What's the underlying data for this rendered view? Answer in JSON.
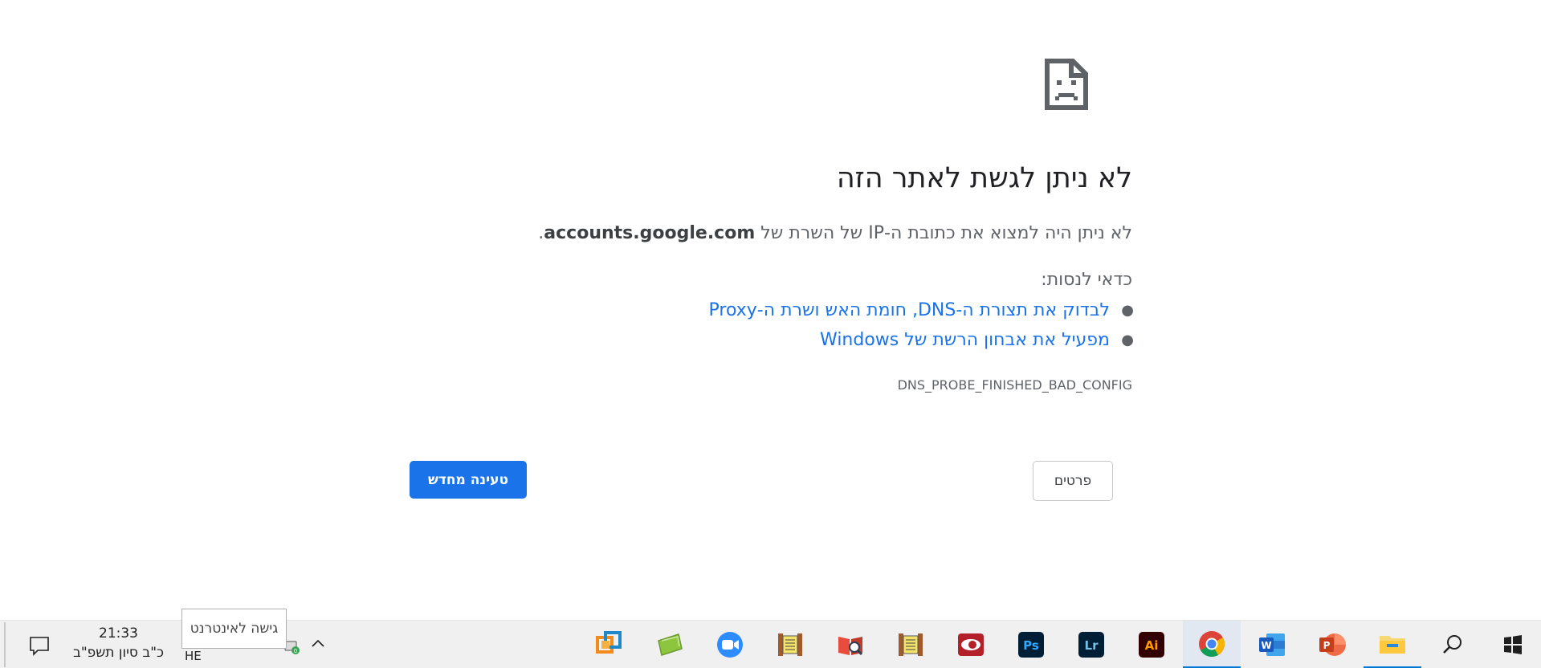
{
  "error": {
    "icon": "sad-document-icon",
    "title": "לא ניתן לגשת לאתר הזה",
    "desc_prefix": "לא ניתן היה למצוא את כתובת ה-IP של השרת של",
    "host": "accounts.google.com",
    "desc_suffix": ".",
    "try_label": "כדאי לנסות:",
    "suggestions": [
      "לבדוק את תצורת ה-DNS, חומת האש ושרת ה-Proxy",
      "מפעיל את אבחון הרשת של Windows"
    ],
    "code": "DNS_PROBE_FINISHED_BAD_CONFIG"
  },
  "buttons": {
    "details": "פרטים",
    "reload": "טעינה מחדש"
  },
  "taskbar": {
    "time": "21:33",
    "date": "כ\"ב סיון תשפ\"ב",
    "language": "HE",
    "tooltip": "גישה לאינטרנט",
    "apps": [
      "virtualbox-icon",
      "green-app-icon",
      "zoom-icon",
      "torah-scroll-icon",
      "book-search-icon",
      "torah-scroll-icon",
      "red-eye-app-icon",
      "photoshop-icon",
      "lightroom-icon",
      "illustrator-icon",
      "chrome-icon",
      "word-icon",
      "powerpoint-icon",
      "file-explorer-icon",
      "search-icon",
      "windows-start-icon"
    ],
    "accent_color": "#0078d4"
  },
  "colors": {
    "link": "#1a73e8",
    "primary_button": "#1a73e8",
    "text_secondary": "#5f6368"
  }
}
